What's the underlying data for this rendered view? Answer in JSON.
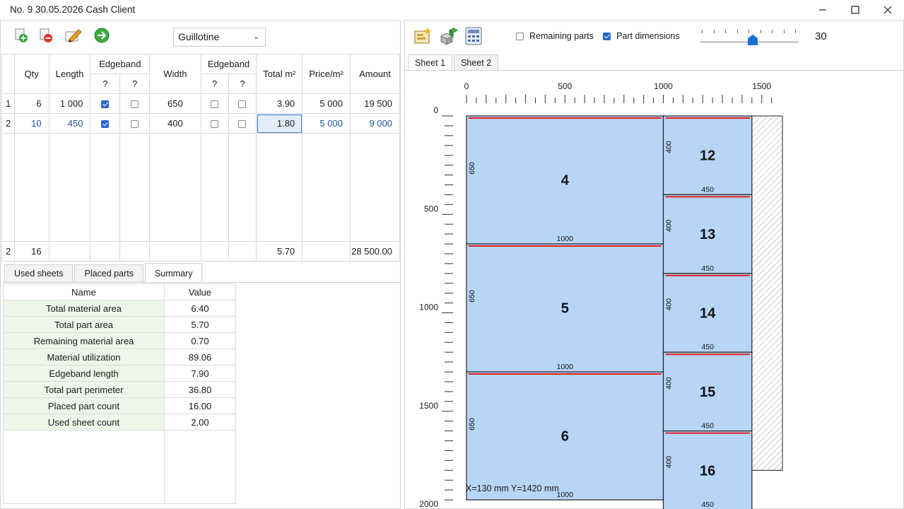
{
  "window": {
    "title": "No. 9  30.05.2026 Cash Client",
    "minimize_icon": "minimize-icon",
    "maximize_icon": "maximize-icon",
    "close_icon": "close-icon"
  },
  "left_toolbar": {
    "icons": [
      "add-part-icon",
      "remove-part-icon",
      "edit-icon",
      "go-next-icon"
    ],
    "cut_mode": "Guillotine"
  },
  "parts_table": {
    "headers": {
      "qty": "Qty",
      "length": "Length",
      "edgeband_a": "Edgeband",
      "width": "Width",
      "edgeband_b": "Edgeband",
      "total": "Total m²",
      "price": "Price/m²",
      "amount": "Amount",
      "q": "?"
    },
    "rows": [
      {
        "idx": "1",
        "qty": "6",
        "length": "1 000",
        "eb_len_1": true,
        "eb_len_2": false,
        "width": "650",
        "eb_w_1": false,
        "eb_w_2": false,
        "total": "3.90",
        "price": "5 000",
        "amount": "19 500"
      },
      {
        "idx": "2",
        "qty": "10",
        "length": "450",
        "eb_len_1": true,
        "eb_len_2": false,
        "width": "400",
        "eb_w_1": false,
        "eb_w_2": false,
        "total": "1.80",
        "price": "5 000",
        "amount": "9 000"
      }
    ],
    "footer": {
      "idx": "2",
      "qty": "16",
      "total": "5.70",
      "amount": "28 500.00"
    }
  },
  "bottom_tabs": [
    "Used sheets",
    "Placed parts",
    "Summary"
  ],
  "summary": {
    "headers": {
      "name": "Name",
      "value": "Value"
    },
    "rows": [
      {
        "name": "Total material area",
        "value": "6.40"
      },
      {
        "name": "Total part area",
        "value": "5.70"
      },
      {
        "name": "Remaining material area",
        "value": "0.70"
      },
      {
        "name": "Material utilization",
        "value": "89.06"
      },
      {
        "name": "Edgeband length",
        "value": "7.90"
      },
      {
        "name": "Total part perimeter",
        "value": "36.80"
      },
      {
        "name": "Placed part count",
        "value": "16.00"
      },
      {
        "name": "Used sheet count",
        "value": "2.00"
      }
    ]
  },
  "right_toolbar": {
    "icons": [
      "new-layout-icon",
      "parts-3d-icon",
      "calculator-icon"
    ],
    "remaining_parts": {
      "label": "Remaining parts",
      "checked": false
    },
    "part_dimensions": {
      "label": "Part dimensions",
      "checked": true
    },
    "zoom_value": "30",
    "zoom_fraction": 0.5
  },
  "sheet_tabs": [
    "Sheet 1",
    "Sheet 2"
  ],
  "sheet": {
    "x_ticks": [
      "0",
      "500",
      "1000",
      "1500"
    ],
    "y_ticks": [
      "0",
      "500",
      "1000",
      "1500",
      "2000"
    ],
    "parts": [
      {
        "id": "4",
        "x": 0,
        "y": 0,
        "w": 1000,
        "h": 650,
        "len_label": "1000",
        "wid_label": "650"
      },
      {
        "id": "5",
        "x": 0,
        "y": 650,
        "w": 1000,
        "h": 650,
        "len_label": "1000",
        "wid_label": "650"
      },
      {
        "id": "6",
        "x": 0,
        "y": 1300,
        "w": 1000,
        "h": 650,
        "len_label": "1000",
        "wid_label": "650"
      },
      {
        "id": "12",
        "x": 1000,
        "y": 0,
        "w": 450,
        "h": 400,
        "len_label": "450",
        "wid_label": "400"
      },
      {
        "id": "13",
        "x": 1000,
        "y": 400,
        "w": 450,
        "h": 400,
        "len_label": "450",
        "wid_label": "400"
      },
      {
        "id": "14",
        "x": 1000,
        "y": 800,
        "w": 450,
        "h": 400,
        "len_label": "450",
        "wid_label": "400"
      },
      {
        "id": "15",
        "x": 1000,
        "y": 1200,
        "w": 450,
        "h": 400,
        "len_label": "450",
        "wid_label": "400"
      },
      {
        "id": "16",
        "x": 1000,
        "y": 1600,
        "w": 450,
        "h": 400,
        "len_label": "450",
        "wid_label": "400"
      }
    ],
    "cursor_readout": "X=130 mm   Y=1420 mm",
    "colors": {
      "part_fill": "#b7d5f6",
      "edgeband": "#e01e1e",
      "waste_hatch": "#9a9a9a"
    }
  }
}
